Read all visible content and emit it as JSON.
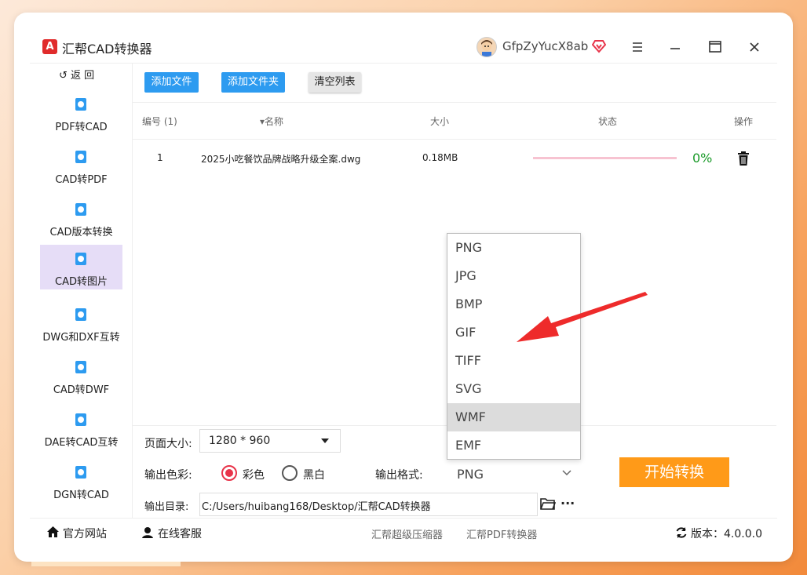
{
  "app": {
    "title": "汇帮CAD转换器",
    "logo_letter": "A",
    "username": "GfpZyYucX8ab"
  },
  "sidebar": {
    "back_label": "↺ 返 回",
    "items": [
      {
        "label": "PDF转CAD"
      },
      {
        "label": "CAD转PDF"
      },
      {
        "label": "CAD版本转换"
      },
      {
        "label": "CAD转图片"
      },
      {
        "label": "DWG和DXF互转"
      },
      {
        "label": "CAD转DWF"
      },
      {
        "label": "DAE转CAD互转"
      },
      {
        "label": "DGN转CAD"
      }
    ]
  },
  "toolbar": {
    "add_file": "添加文件",
    "add_folder": "添加文件夹",
    "clear_list": "清空列表"
  },
  "table": {
    "headers": {
      "index": "编号 (1)",
      "name": "▾名称",
      "size": "大小",
      "status": "状态",
      "action": "操作"
    },
    "rows": [
      {
        "index": "1",
        "name": "2025小吃餐饮品牌战略升级全案.dwg",
        "size": "0.18MB",
        "progress": "0%",
        "progress_value": 0
      }
    ]
  },
  "settings": {
    "page_size_label": "页面大小:",
    "page_size_value": "1280 * 960",
    "color_label": "输出色彩:",
    "color_option_color": "彩色",
    "color_option_bw": "黑白",
    "format_label": "输出格式:",
    "format_value": "PNG",
    "dir_label": "输出目录:",
    "dir_value": "C:/Users/huibang168/Desktop/汇帮CAD转换器",
    "more": "···"
  },
  "format_dropdown": {
    "options": [
      "PNG",
      "JPG",
      "BMP",
      "GIF",
      "TIFF",
      "SVG",
      "WMF",
      "EMF"
    ],
    "highlighted": "WMF"
  },
  "start_button": "开始转换",
  "footer": {
    "website": "官方网站",
    "support": "在线客服",
    "link1": "汇帮超级压缩器",
    "link2": "汇帮PDF转换器",
    "version": "版本：4.0.0.0"
  },
  "colors": {
    "accent_blue": "#2d9bf0",
    "start_orange": "#ff9a18",
    "active_side": "#e6ddf7",
    "arrow_red": "#ee2b2b",
    "progress_green": "#1a9a29"
  }
}
